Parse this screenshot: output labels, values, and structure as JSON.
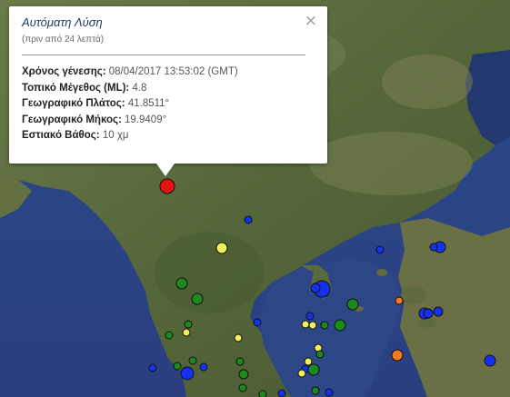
{
  "popup": {
    "title": "Αυτόματη Λύση",
    "subtitle": "(πριν από 24 λεπτά)",
    "close_glyph": "×",
    "fields": [
      {
        "label": "Χρόνος γένεσης:",
        "value": "08/04/2017  13:53:02 (GMT)"
      },
      {
        "label": "Τοπικό Μέγεθος (ML):",
        "value": "4.8"
      },
      {
        "label": "Γεωγραφικό Πλάτος:",
        "value": "41.8511°"
      },
      {
        "label": "Γεωγραφικό Μήκος:",
        "value": "19.9409°"
      },
      {
        "label": "Εστιακό Βάθος:",
        "value": "10 χμ"
      }
    ]
  },
  "colors": {
    "sea": "#2f4b8c",
    "land": "#5a6b3e",
    "selected_marker": "#e51414",
    "blue_marker": "#1530f0",
    "green_marker": "#1c8a1c",
    "yellow_marker": "#f2f05a",
    "orange_marker": "#f07a1c"
  }
}
